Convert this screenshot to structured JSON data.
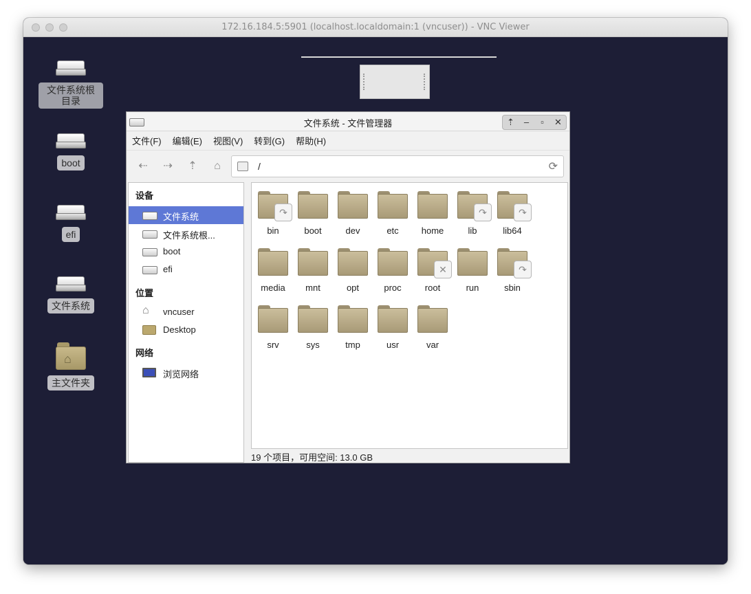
{
  "vnc": {
    "title": "172.16.184.5:5901 (localhost.localdomain:1 (vncuser)) - VNC Viewer"
  },
  "desktop_icons": [
    {
      "label": "文件系统根目录",
      "kind": "drive",
      "selected": true
    },
    {
      "label": "boot",
      "kind": "drive",
      "selected": false
    },
    {
      "label": "efi",
      "kind": "drive",
      "selected": false
    },
    {
      "label": "文件系统",
      "kind": "drive",
      "selected": false
    },
    {
      "label": "主文件夹",
      "kind": "home",
      "selected": false
    }
  ],
  "fm": {
    "title": "文件系统 - 文件管理器",
    "menu": [
      "文件(F)",
      "编辑(E)",
      "视图(V)",
      "转到(G)",
      "帮助(H)"
    ],
    "location": "/",
    "sidebar": {
      "devices_header": "设备",
      "places_header": "位置",
      "network_header": "网络",
      "devices": [
        "文件系统",
        "文件系统根...",
        "boot",
        "efi"
      ],
      "places": [
        "vncuser",
        "Desktop"
      ],
      "network": [
        "浏览网络"
      ]
    },
    "folders": [
      {
        "name": "bin",
        "emblem": "link"
      },
      {
        "name": "boot",
        "emblem": ""
      },
      {
        "name": "dev",
        "emblem": ""
      },
      {
        "name": "etc",
        "emblem": ""
      },
      {
        "name": "home",
        "emblem": ""
      },
      {
        "name": "lib",
        "emblem": "link"
      },
      {
        "name": "lib64",
        "emblem": "link"
      },
      {
        "name": "media",
        "emblem": ""
      },
      {
        "name": "mnt",
        "emblem": ""
      },
      {
        "name": "opt",
        "emblem": ""
      },
      {
        "name": "proc",
        "emblem": ""
      },
      {
        "name": "root",
        "emblem": "locked"
      },
      {
        "name": "run",
        "emblem": ""
      },
      {
        "name": "sbin",
        "emblem": "link"
      },
      {
        "name": "srv",
        "emblem": ""
      },
      {
        "name": "sys",
        "emblem": ""
      },
      {
        "name": "tmp",
        "emblem": ""
      },
      {
        "name": "usr",
        "emblem": ""
      },
      {
        "name": "var",
        "emblem": ""
      }
    ],
    "status": "19 个项目，可用空间: 13.0 GB"
  },
  "icons": {
    "back": "back-icon",
    "forward": "forward-icon",
    "up": "up-icon",
    "home": "home-icon",
    "refresh": "refresh-icon"
  },
  "colors": {
    "desktop": "#1d1e36",
    "selection": "#5e78d6",
    "folder": "#b9ab86"
  }
}
